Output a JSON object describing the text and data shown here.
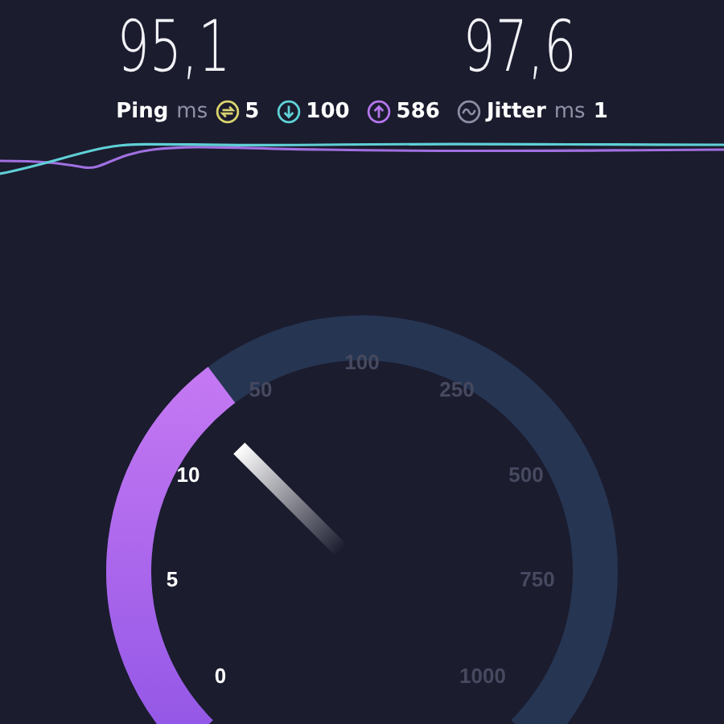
{
  "results": [
    {
      "value": "95,1"
    },
    {
      "value": "97,6"
    }
  ],
  "stats": [
    {
      "kind": "label",
      "text": "Ping"
    },
    {
      "kind": "unit",
      "text": "ms"
    },
    {
      "kind": "ping",
      "text": "5",
      "color": "#d9d46e"
    },
    {
      "kind": "download",
      "text": "100",
      "color": "#5ed2d6"
    },
    {
      "kind": "upload",
      "text": "586",
      "color": "#b476ec"
    },
    {
      "kind": "jitter",
      "text": "Jitter",
      "color": "#8c8ea4"
    },
    {
      "kind": "unit",
      "text": "ms"
    },
    {
      "kind": "value",
      "text": "1"
    }
  ],
  "gauge": {
    "ticks": [
      {
        "label": "0",
        "active": true
      },
      {
        "label": "5",
        "active": true
      },
      {
        "label": "10",
        "active": true
      },
      {
        "label": "50",
        "active": false
      },
      {
        "label": "100",
        "active": false
      },
      {
        "label": "250",
        "active": false
      },
      {
        "label": "500",
        "active": false
      },
      {
        "label": "750",
        "active": false
      },
      {
        "label": "1000",
        "active": false
      }
    ]
  }
}
